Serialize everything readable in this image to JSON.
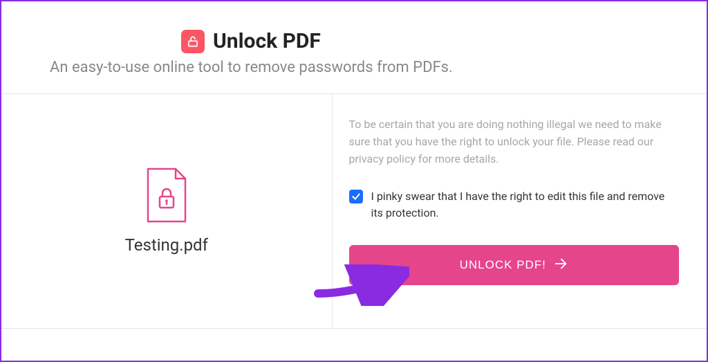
{
  "header": {
    "title": "Unlock PDF",
    "subtitle": "An easy-to-use online tool to remove passwords from PDFs."
  },
  "file": {
    "name": "Testing.pdf"
  },
  "disclaimer": "To be certain that you are doing nothing illegal we need to make sure that you have the right to unlock your file. Please read our privacy policy for more details.",
  "consent": {
    "checked": true,
    "text": "I pinky swear that I have the right to edit this file and remove its protection."
  },
  "button": {
    "label": "UNLOCK PDF!"
  }
}
